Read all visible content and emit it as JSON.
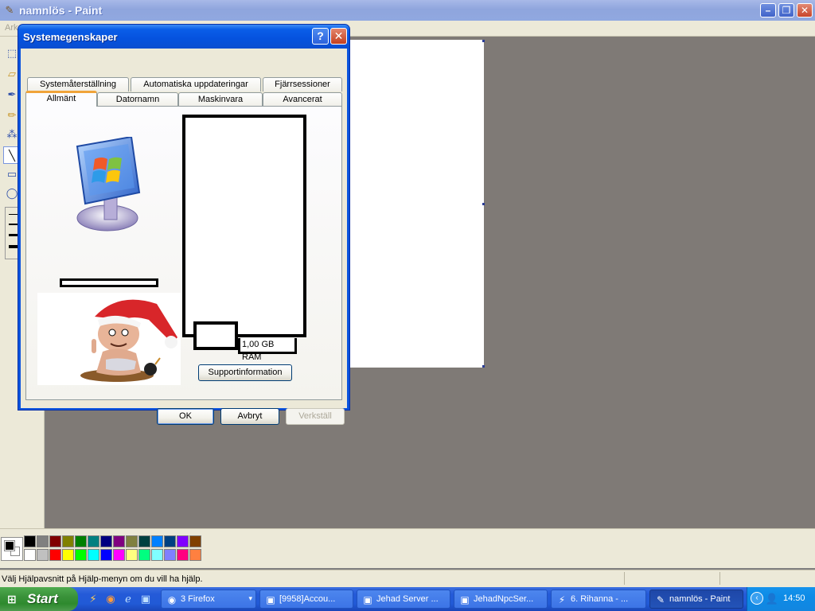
{
  "paint": {
    "title": "namnlös - Paint",
    "menu_partial": "Ark",
    "status": "Välj Hjälpavsnitt på Hjälp-menyn om du vill ha hjälp."
  },
  "dialog": {
    "title": "Systemegenskaper",
    "tabs_row1": [
      "Systemåterställning",
      "Automatiska uppdateringar",
      "Fjärrsessioner"
    ],
    "tabs_row2": [
      "Allmänt",
      "Datornamn",
      "Maskinvara",
      "Avancerat"
    ],
    "selected_tab": "Allmänt",
    "ram_text": "1,00 GB RAM",
    "support_button": "Supportinformation",
    "ok_button": "OK",
    "cancel_button": "Avbryt",
    "apply_button": "Verkställ"
  },
  "palette": {
    "top": [
      "#000000",
      "#808080",
      "#800000",
      "#808000",
      "#008000",
      "#008080",
      "#000080",
      "#800080",
      "#808040",
      "#004040",
      "#0080ff",
      "#004080",
      "#8000ff",
      "#804000"
    ],
    "bottom": [
      "#ffffff",
      "#c0c0c0",
      "#ff0000",
      "#ffff00",
      "#00ff00",
      "#00ffff",
      "#0000ff",
      "#ff00ff",
      "#ffff80",
      "#00ff80",
      "#80ffff",
      "#8080ff",
      "#ff0080",
      "#ff8040"
    ]
  },
  "taskbar": {
    "start": "Start",
    "tasks": [
      {
        "label": "3 Firefox",
        "icon": "firefox-icon",
        "active": false
      },
      {
        "label": "[9958]Accou...",
        "icon": "app-icon",
        "active": false
      },
      {
        "label": "Jehad Server ...",
        "icon": "app-icon",
        "active": false
      },
      {
        "label": "JehadNpcSer...",
        "icon": "app-icon",
        "active": false
      },
      {
        "label": "6. Rihanna - ...",
        "icon": "winamp-icon",
        "active": false
      },
      {
        "label": "namnlös - Paint",
        "icon": "paint-icon",
        "active": true
      }
    ],
    "clock": "14:50"
  }
}
